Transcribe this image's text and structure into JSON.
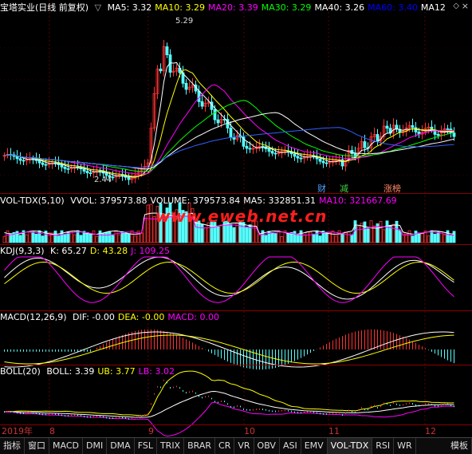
{
  "main": {
    "stock_name": "宝塔实业(日线 前复权)",
    "ma": [
      {
        "label": "MA5: 3.32",
        "color": "#ffffff"
      },
      {
        "label": "MA10: 3.29",
        "color": "#ffff00"
      },
      {
        "label": "MA20: 3.39",
        "color": "#ff00ff"
      },
      {
        "label": "MA30: 3.29",
        "color": "#00ff00"
      },
      {
        "label": "MA40: 3.26",
        "color": "#ffffff"
      },
      {
        "label": "MA60: 3.40",
        "color": "#0000ff"
      },
      {
        "label": "MA12",
        "color": "#ffffff"
      }
    ],
    "high_label": "5.29",
    "low_label": "2.44",
    "markers": [
      {
        "text": "财",
        "color": "#4da3ff"
      },
      {
        "text": "减",
        "color": "#3fd13f"
      },
      {
        "text": "涨榜",
        "color": "#ff8a65"
      }
    ]
  },
  "vol": {
    "name": "VOL-TDX(5,10)",
    "items": [
      {
        "label": "VVOL: 379573.88",
        "color": "#ffffff"
      },
      {
        "label": "VOLUME: 379573.84",
        "color": "#ffffff"
      },
      {
        "label": "MA5: 332851.31",
        "color": "#ffffff"
      },
      {
        "label": "MA10: 321667.69",
        "color": "#ff00ff"
      }
    ]
  },
  "kdj": {
    "name": "KDJ(9,3,3)",
    "items": [
      {
        "label": "K: 65.27",
        "color": "#ffffff"
      },
      {
        "label": "D: 43.28",
        "color": "#ffff00"
      },
      {
        "label": "J: 109.25",
        "color": "#ff00ff"
      }
    ]
  },
  "macd": {
    "name": "MACD(12,26,9)",
    "items": [
      {
        "label": "DIF: -0.00",
        "color": "#ffffff"
      },
      {
        "label": "DEA: -0.00",
        "color": "#ffff00"
      },
      {
        "label": "MACD: 0.00",
        "color": "#ff00ff"
      }
    ]
  },
  "boll": {
    "name": "BOLL(20)",
    "items": [
      {
        "label": "BOLL: 3.39",
        "color": "#ffffff"
      },
      {
        "label": "UB: 3.77",
        "color": "#ffff00"
      },
      {
        "label": "LB: 3.02",
        "color": "#ff00ff"
      }
    ]
  },
  "watermark": "www.eweb.net.cn",
  "dates": [
    "2019年",
    "8",
    "9",
    "10",
    "11",
    "12"
  ],
  "tabs": [
    "指标",
    "窗口",
    "MACD",
    "DMI",
    "DMA",
    "FSL",
    "TRIX",
    "BRAR",
    "CR",
    "VR",
    "OBV",
    "ASI",
    "EMV",
    "VOL-TDX",
    "RSI",
    "WR",
    "模板"
  ],
  "active_tab": "VOL-TDX"
}
